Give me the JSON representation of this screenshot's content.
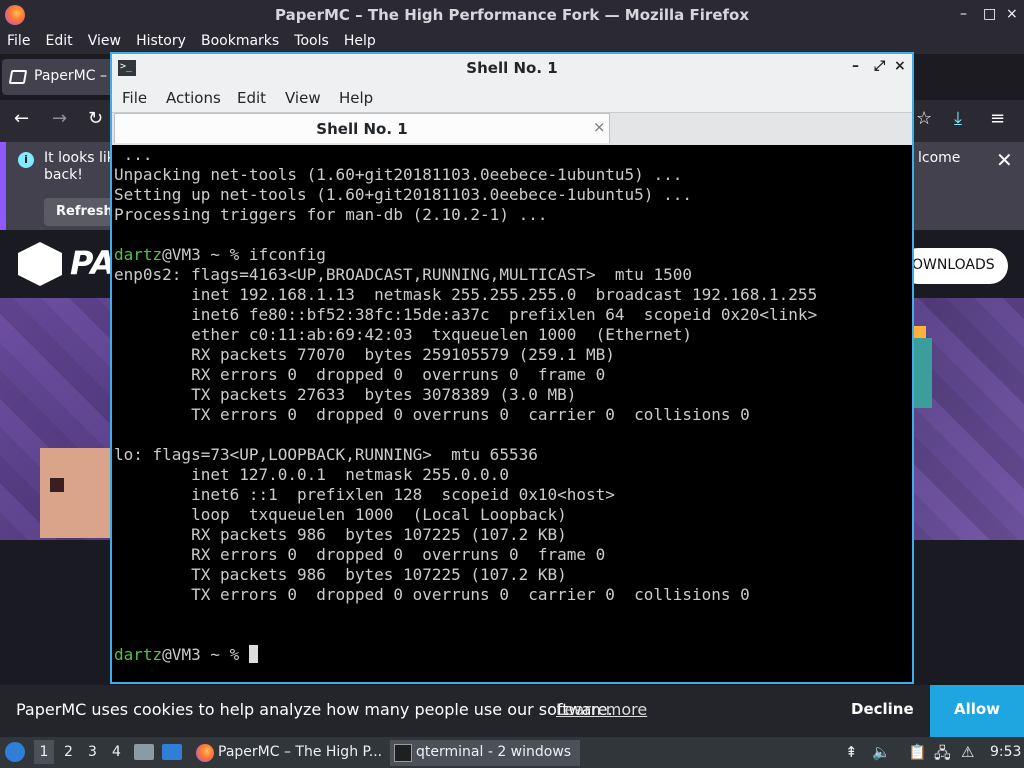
{
  "firefox": {
    "window_title": "PaperMC – The High Performance Fork — Mozilla Firefox",
    "window_controls": [
      "–",
      "□",
      "×"
    ],
    "menu": [
      "File",
      "Edit",
      "View",
      "History",
      "Bookmarks",
      "Tools",
      "Help"
    ],
    "tab_label": "PaperMC – T",
    "nav_icons": [
      "←",
      "→",
      "↻",
      "☆",
      "⤓",
      "≡"
    ],
    "notification": {
      "message": "It looks lik back!",
      "message_tail": "lcome",
      "refresh_label": "Refresh",
      "close": "✕"
    },
    "page": {
      "logo_text": "PA",
      "downloads_label": "OWNLOADS"
    },
    "cookie": {
      "text": "PaperMC uses cookies to help analyze how many people use our software.",
      "learn_more": "Learn more",
      "decline": "Decline",
      "allow": "Allow"
    }
  },
  "terminal": {
    "window_title": "Shell No. 1",
    "title_controls": [
      "–",
      "⤢",
      "×"
    ],
    "menu": [
      "File",
      "Actions",
      "Edit",
      "View",
      "Help"
    ],
    "tab_label": "Shell No. 1",
    "tab_close": "×",
    "lines": [
      {
        "text": " ..."
      },
      {
        "text": "Unpacking net-tools (1.60+git20181103.0eebece-1ubuntu5) ..."
      },
      {
        "text": "Setting up net-tools (1.60+git20181103.0eebece-1ubuntu5) ..."
      },
      {
        "text": "Processing triggers for man-db (2.10.2-1) ..."
      },
      {
        "text": ""
      },
      {
        "user": "dartz",
        "text": "@VM3 ~ % ifconfig"
      },
      {
        "text": "enp0s2: flags=4163<UP,BROADCAST,RUNNING,MULTICAST>  mtu 1500"
      },
      {
        "text": "        inet 192.168.1.13  netmask 255.255.255.0  broadcast 192.168.1.255"
      },
      {
        "text": "        inet6 fe80::bf52:38fc:15de:a37c  prefixlen 64  scopeid 0x20<link>"
      },
      {
        "text": "        ether c0:11:ab:69:42:03  txqueuelen 1000  (Ethernet)"
      },
      {
        "text": "        RX packets 77070  bytes 259105579 (259.1 MB)"
      },
      {
        "text": "        RX errors 0  dropped 0  overruns 0  frame 0"
      },
      {
        "text": "        TX packets 27633  bytes 3078389 (3.0 MB)"
      },
      {
        "text": "        TX errors 0  dropped 0 overruns 0  carrier 0  collisions 0"
      },
      {
        "text": ""
      },
      {
        "text": "lo: flags=73<UP,LOOPBACK,RUNNING>  mtu 65536"
      },
      {
        "text": "        inet 127.0.0.1  netmask 255.0.0.0"
      },
      {
        "text": "        inet6 ::1  prefixlen 128  scopeid 0x10<host>"
      },
      {
        "text": "        loop  txqueuelen 1000  (Local Loopback)"
      },
      {
        "text": "        RX packets 986  bytes 107225 (107.2 KB)"
      },
      {
        "text": "        RX errors 0  dropped 0  overruns 0  frame 0"
      },
      {
        "text": "        TX packets 986  bytes 107225 (107.2 KB)"
      },
      {
        "text": "        TX errors 0  dropped 0 overruns 0  carrier 0  collisions 0"
      },
      {
        "text": ""
      },
      {
        "text": ""
      },
      {
        "user": "dartz",
        "text": "@VM3 ~ % ",
        "cursor": true
      }
    ]
  },
  "taskbar": {
    "workspaces": [
      "1",
      "2",
      "3",
      "4"
    ],
    "active_workspace": "1",
    "tasks": [
      {
        "label": "PaperMC – The High P...",
        "icon": "firefox-icon",
        "active": false
      },
      {
        "label": "qterminal - 2 windows",
        "icon": "terminal-icon",
        "active": true
      }
    ],
    "clock": "9:53"
  },
  "colors": {
    "accent": "#3daee9",
    "prompt_user": "#54c245",
    "allow_button": "#1fa6e0"
  }
}
